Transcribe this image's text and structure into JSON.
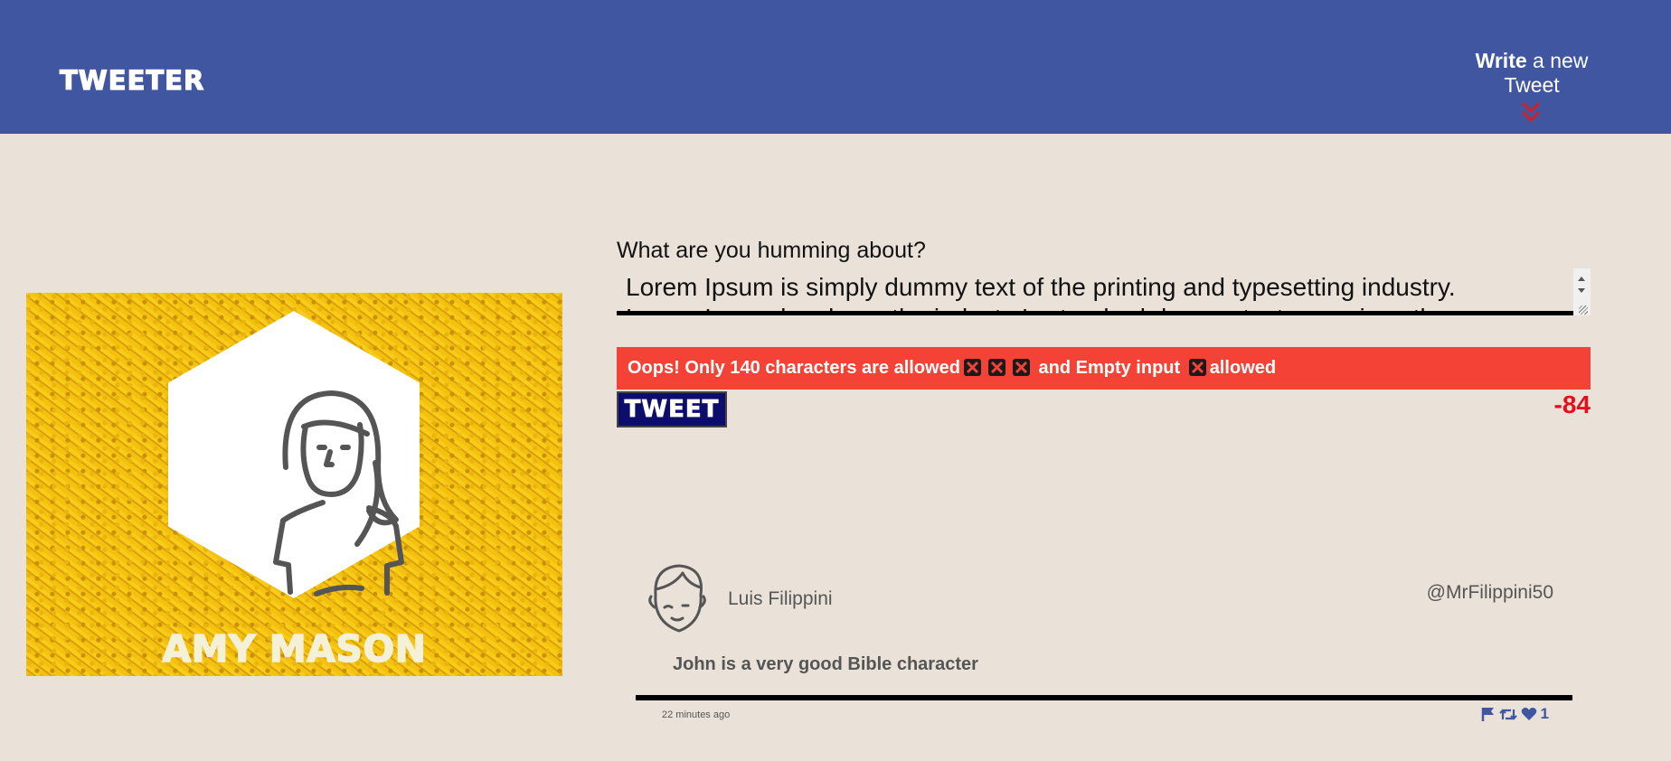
{
  "nav": {
    "logo": "TWEETER",
    "compose_bold": "Write",
    "compose_rest": " a new Tweet",
    "compose_icon": "double-chevron-down-icon"
  },
  "profile": {
    "name": "AMY MASON",
    "avatar_icon": "woman-avatar-icon"
  },
  "compose": {
    "prompt": "What are you humming about?",
    "tweet_text": "Lorem Ipsum is simply dummy text of the printing and typesetting industry. Lorem Ipsum has been the industry's standard dummy text ever since the",
    "error_part1": "Oops! Only 140 characters are allowed",
    "error_part2": " and Empty input ",
    "error_part3": "allowed",
    "error_icon": "cross-mark-icon",
    "button_label": "TWEET",
    "counter": "-84"
  },
  "tweet": {
    "name": "Luis Filippini",
    "handle": "@MrFilippini50",
    "text": "John is a very good Bible character",
    "time": "22 minutes ago",
    "likes": "1",
    "icons": [
      "flag-icon",
      "retweet-icon",
      "heart-icon"
    ]
  },
  "colors": {
    "nav": "#4056A1",
    "background": "#EAE2D8",
    "error": "#F44336",
    "button": "#0D0D6B",
    "counter": "#E3111B",
    "profile_bg": "#F1BD10"
  }
}
